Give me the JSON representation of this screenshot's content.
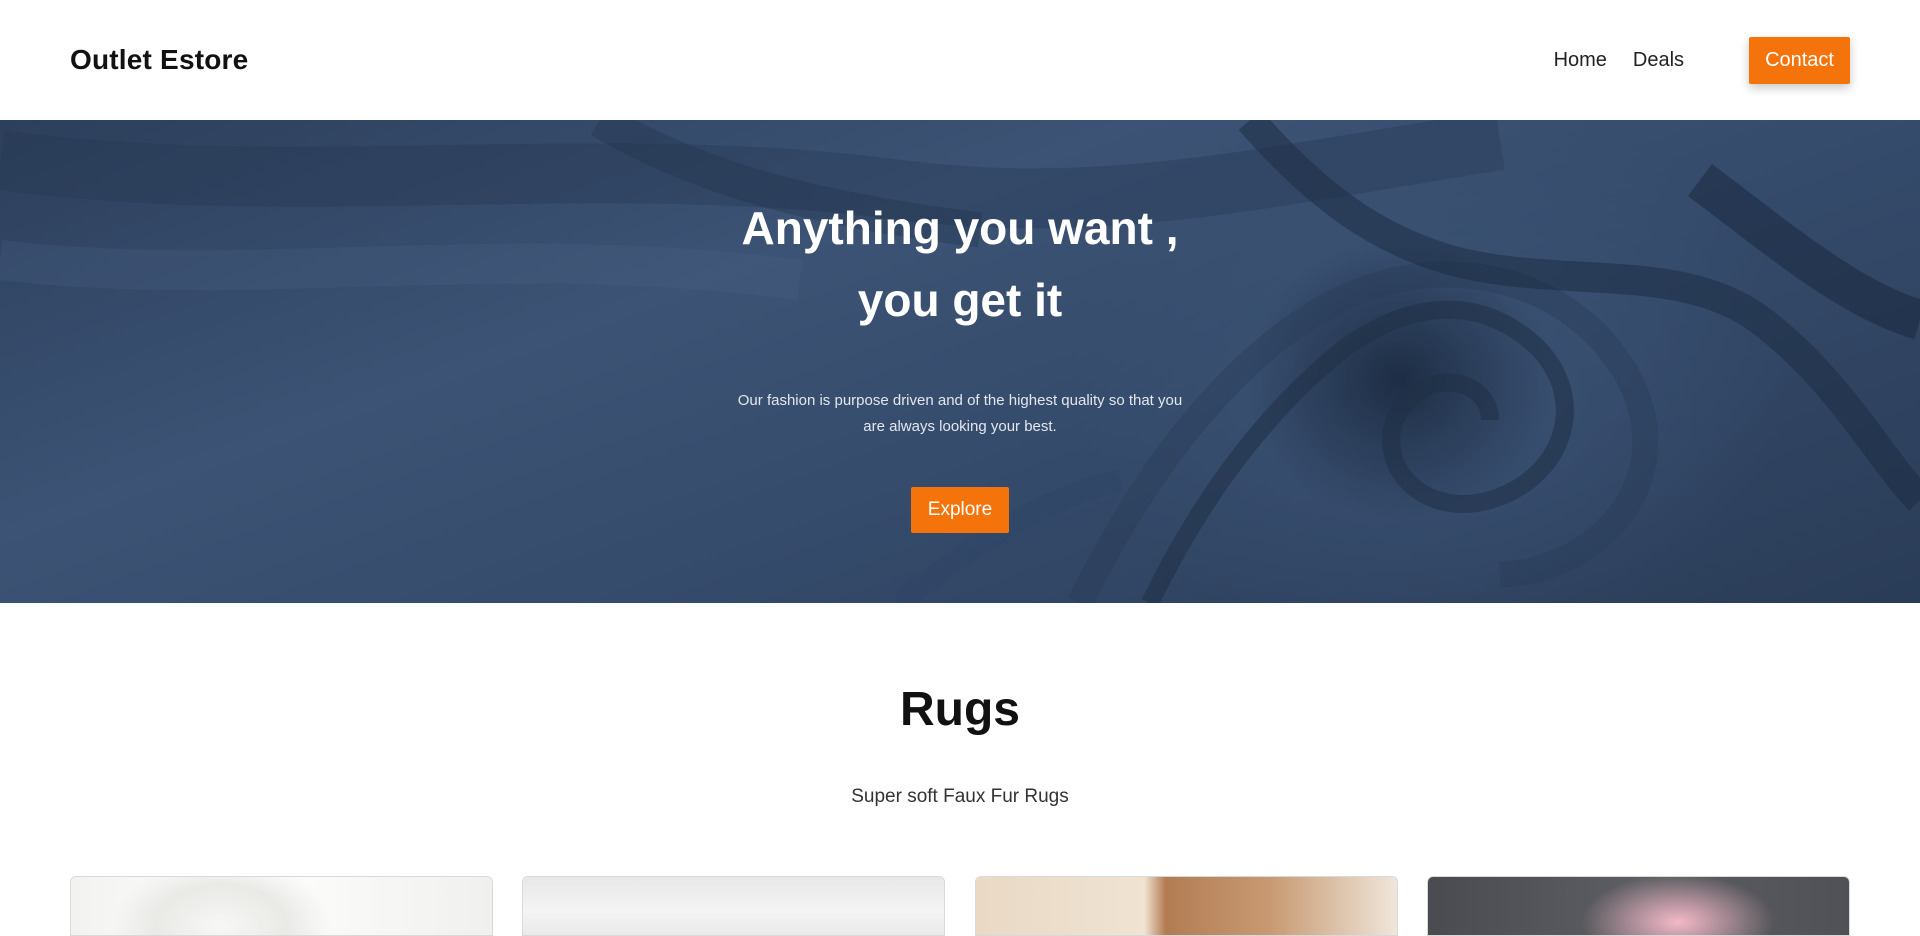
{
  "header": {
    "brand": "Outlet Estore",
    "nav": [
      {
        "label": "Home"
      },
      {
        "label": "Deals"
      }
    ],
    "contact_label": "Contact"
  },
  "hero": {
    "title_line1": "Anything you want ,",
    "title_line2": "you get it",
    "description": "Our fashion is purpose driven and of the highest quality so that you are always looking your best.",
    "cta_label": "Explore"
  },
  "section": {
    "title": "Rugs",
    "subtitle": "Super soft Faux Fur Rugs"
  },
  "colors": {
    "accent": "#f5730b",
    "hero_fabric": "#3a5070",
    "text_dark": "#111111"
  }
}
